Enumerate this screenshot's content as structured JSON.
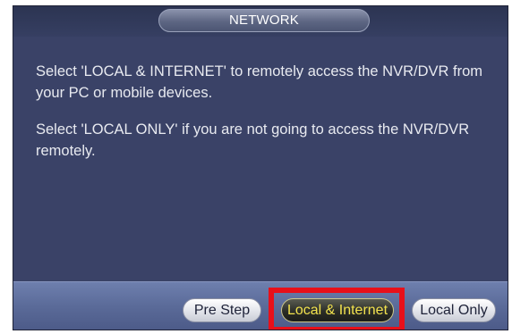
{
  "dialog": {
    "title": "NETWORK"
  },
  "content": {
    "message_1": "Select 'LOCAL & INTERNET' to remotely access the NVR/DVR from your PC or mobile devices.",
    "message_2": "Select 'LOCAL ONLY' if you are not going to access the NVR/DVR remotely."
  },
  "footer": {
    "pre_step_label": "Pre Step",
    "local_internet_label": "Local & Internet",
    "local_only_label": "Local Only",
    "selected_button": "Local & Internet"
  },
  "colors": {
    "dialog_bg": "#3a4267",
    "footer_bg": "#5a6a98",
    "selected_text": "#f2e24e",
    "highlight_frame": "#e8101a"
  }
}
